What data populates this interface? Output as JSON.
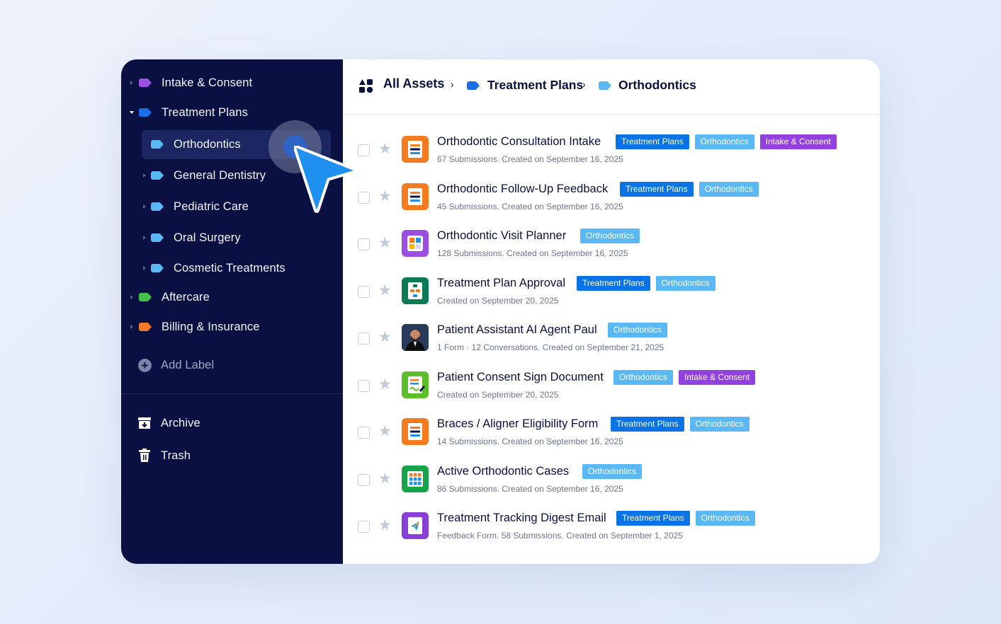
{
  "sidebar": {
    "labels": [
      {
        "label": "Intake & Consent",
        "color": "#9b4ee0"
      },
      {
        "label": "Treatment Plans",
        "color": "#1a6fe6"
      },
      {
        "label": "Orthodontics",
        "color": "#5ab8f5"
      },
      {
        "label": "General Dentistry",
        "color": "#5ab8f5"
      },
      {
        "label": "Pediatric Care",
        "color": "#5ab8f5"
      },
      {
        "label": "Oral Surgery",
        "color": "#5ab8f5"
      },
      {
        "label": "Cosmetic Treatments",
        "color": "#5ab8f5"
      },
      {
        "label": "Aftercare",
        "color": "#42c248"
      },
      {
        "label": "Billing & Insurance",
        "color": "#f47b2a"
      }
    ],
    "add_label": "Add Label",
    "archive": "Archive",
    "trash": "Trash"
  },
  "breadcrumb": {
    "root": "All Assets",
    "level1": "Treatment Plans",
    "level2": "Orthodontics"
  },
  "assets": [
    {
      "title": "Orthodontic Consultation Intake",
      "subtitle": "67 Submissions. Created on September 16, 2025",
      "icon": "form-icon",
      "icon_color": "#f47b20",
      "badges": [
        "Treatment Plans",
        "Orthodontics",
        "Intake & Consent"
      ]
    },
    {
      "title": "Orthodontic Follow-Up Feedback",
      "subtitle": "45 Submissions. Created on September 16, 2025",
      "icon": "form-icon",
      "icon_color": "#f47b20",
      "badges": [
        "Treatment Plans",
        "Orthodontics"
      ]
    },
    {
      "title": "Orthodontic Visit Planner",
      "subtitle": "128 Submissions. Created on September 16, 2025",
      "icon": "app-grid-icon",
      "icon_color": "#9b4ee0",
      "badges": [
        "Orthodontics"
      ]
    },
    {
      "title": "Treatment Plan Approval",
      "subtitle": "Created on September 20, 2025",
      "icon": "workflow-icon",
      "icon_color": "#0b7a55",
      "badges": [
        "Treatment Plans",
        "Orthodontics"
      ]
    },
    {
      "title": "Patient Assistant AI Agent Paul",
      "subtitle": "1 Form · 12 Conversations. Created on September 21, 2025",
      "icon": "agent-avatar-icon",
      "icon_color": "#2a3a5a",
      "badges": [
        "Orthodontics"
      ]
    },
    {
      "title": "Patient Consent Sign Document",
      "subtitle": "Created on September 20, 2025",
      "icon": "sign-document-icon",
      "icon_color": "#5cbf2a",
      "badges": [
        "Orthodontics",
        "Intake & Consent"
      ]
    },
    {
      "title": "Braces / Aligner Eligibility Form",
      "subtitle": "14 Submissions. Created on September 16, 2025",
      "icon": "form-icon",
      "icon_color": "#f47b20",
      "badges": [
        "Treatment Plans",
        "Orthodontics"
      ]
    },
    {
      "title": "Active Orthodontic Cases",
      "subtitle": "86 Submissions. Created on September 16, 2025",
      "icon": "table-icon",
      "icon_color": "#17a34a",
      "badges": [
        "Orthodontics"
      ]
    },
    {
      "title": "Treatment Tracking Digest Email",
      "subtitle": "Feedback Form. 58 Submissions. Created on September 1, 2025",
      "icon": "email-digest-icon",
      "icon_color": "#8a3fd6",
      "badges": [
        "Treatment Plans",
        "Orthodontics"
      ]
    }
  ],
  "badge_colors": {
    "Treatment Plans": "#0a73e6",
    "Orthodontics": "#5ab8f5",
    "Intake & Consent": "#9340e0"
  }
}
